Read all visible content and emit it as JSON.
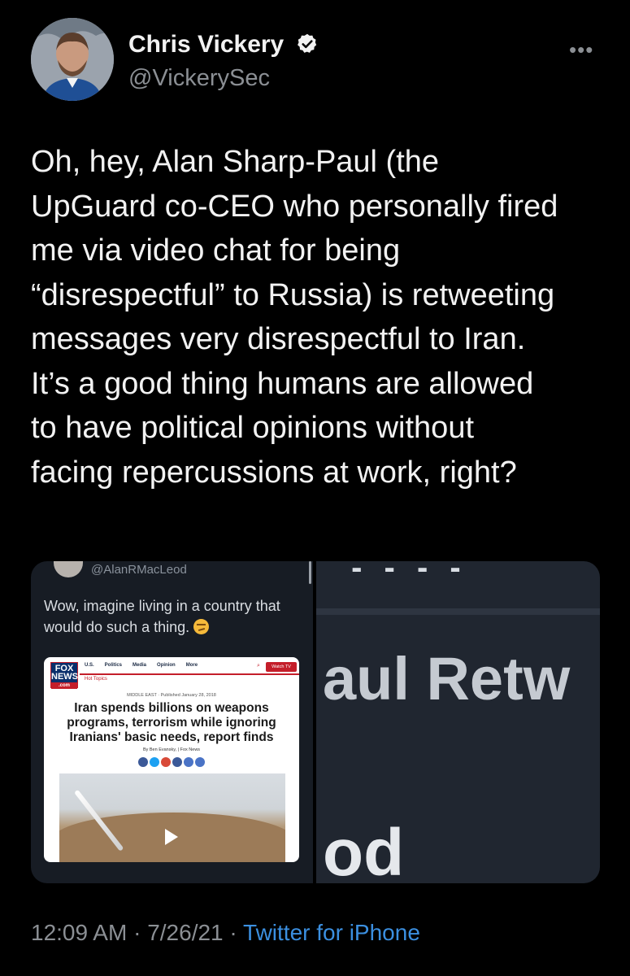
{
  "author": {
    "name": "Chris Vickery",
    "handle": "@VickerySec",
    "verified": true,
    "avatar_icon": "user-avatar"
  },
  "more_label": "•••",
  "tweet": {
    "text": "Oh, hey, Alan Sharp-Paul (the\nUpGuard co-CEO who personally fired\nme via video chat for being\n“disrespectful” to Russia) is retweeting\nmessages very disrespectful to Iran.\nIt’s a good thing humans are allowed\nto have political opinions without\nfacing repercussions at work, right?"
  },
  "media": {
    "left": {
      "retweet_handle": "@AlanRMacLeod",
      "retweet_text": "Wow, imagine living in a country that would do such a thing.",
      "emoji": "smirk-emoji",
      "article": {
        "logo": {
          "line1": "FOX",
          "line2": "NEWS",
          "line3": ".com"
        },
        "nav": [
          "U.S.",
          "Politics",
          "Media",
          "Opinion",
          "More"
        ],
        "watch_tv": "Watch TV",
        "hot_topics": "Hot Topics",
        "meta": "MIDDLE EAST  ·  Published January 28, 2018",
        "headline": "Iran spends billions on weapons programs, terrorism while ignoring Iranians' basic needs, report finds",
        "byline": "By Ben Evansky, | Fox News"
      }
    },
    "right": {
      "top_text": "  -  -  -  - ",
      "mid_text": "aul Retw",
      "bottom_text": "od"
    }
  },
  "footer": {
    "time": "12:09 AM",
    "date": "7/26/21",
    "separator": " · ",
    "source": "Twitter for iPhone"
  },
  "colors": {
    "background": "#000000",
    "text": "#f2f2f2",
    "muted": "#8b8f94",
    "link": "#3b8fe0",
    "verified": "#f2f2f2"
  }
}
